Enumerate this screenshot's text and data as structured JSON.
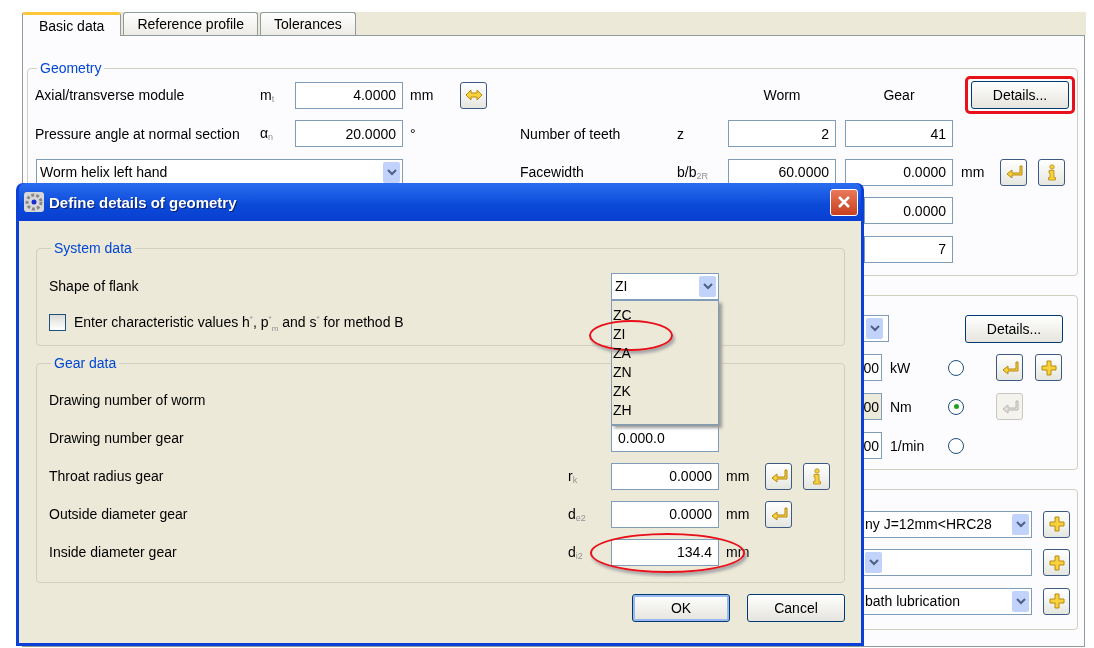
{
  "tabs": [
    {
      "label": "Basic data",
      "selected": true
    },
    {
      "label": "Reference profile",
      "selected": false
    },
    {
      "label": "Tolerances",
      "selected": false
    }
  ],
  "geometry": {
    "title": "Geometry",
    "column_headers": [
      "Worm",
      "Gear"
    ],
    "details_button": {
      "label": "Details...",
      "highlighted": true
    },
    "module": {
      "label": "Axial/transverse module",
      "symbol": "m$_{t}$",
      "value": "4.0000",
      "unit": "mm"
    },
    "pressure_angle": {
      "label": "Pressure angle at normal section",
      "symbol": "α$_{n}$",
      "value": "20.0000",
      "unit": "°"
    },
    "helix": {
      "value": "Worm helix left hand"
    },
    "teeth": {
      "label": "Number of teeth",
      "symbol": "z",
      "worm": "2",
      "gear": "41"
    },
    "facewidth": {
      "label": "Facewidth",
      "symbol": "b/b$_{2R}$",
      "worm": "60.0000",
      "gear": "0.0000",
      "unit": "mm"
    },
    "row_4": {
      "gear": "0.0000"
    },
    "row_5": {
      "gear": "7"
    }
  },
  "group_2": {
    "details_button": {
      "label": "Details..."
    },
    "rows": [
      {
        "value": "00",
        "unit": "kW",
        "selected": false,
        "disabled": false,
        "buttons": [
          {
            "kind": "enter",
            "disabled": false
          },
          {
            "kind": "plus",
            "disabled": false
          }
        ]
      },
      {
        "value": "00",
        "unit": "Nm",
        "selected": true,
        "disabled": true,
        "buttons": [
          {
            "kind": "enter",
            "disabled": true
          }
        ]
      },
      {
        "value": "00",
        "unit": "1/min",
        "selected": false,
        "disabled": false
      }
    ]
  },
  "group_3": {
    "rows": [
      {
        "value": "ny J=12mm<HRC28",
        "buttons": [
          {
            "kind": "plus",
            "disabled": false
          }
        ]
      },
      {
        "buttons": [
          {
            "kind": "plus",
            "disabled": false
          }
        ]
      },
      {
        "value": "bath lubrication",
        "buttons": [
          {
            "kind": "plus",
            "disabled": false
          }
        ]
      }
    ]
  },
  "dialog": {
    "title": "Define details of geometry",
    "system_data": {
      "title": "System data",
      "flank": {
        "label": "Shape of flank",
        "value": "ZI",
        "expanded": true,
        "options": [
          {
            "label": "ZC",
            "highlighted": false
          },
          {
            "label": "ZI",
            "highlighted": true
          },
          {
            "label": "ZA",
            "highlighted": false
          },
          {
            "label": "ZN",
            "highlighted": false
          },
          {
            "label": "ZK",
            "highlighted": false
          },
          {
            "label": "ZH",
            "highlighted": false
          }
        ]
      },
      "method_b": {
        "label": "Enter characteristic values h$^{*}$, p$^{*}$$_{m}$ and s$^{*}$ for method B",
        "checked": false
      }
    },
    "gear_data": {
      "title": "Gear data",
      "rows": [
        {
          "label": "Drawing number of worm"
        },
        {
          "label": "Drawing number gear",
          "kind": "text",
          "value": "0.000.0"
        },
        {
          "label": "Throat radius gear",
          "kind": "number",
          "symbol": "r$_{k}$",
          "value": "0.0000",
          "unit": "mm",
          "buttons": [
            {
              "kind": "enter",
              "disabled": false
            },
            {
              "kind": "info",
              "disabled": false
            }
          ]
        },
        {
          "label": "Outside diameter gear",
          "kind": "number",
          "symbol": "d$_{e2}$",
          "value": "0.0000",
          "unit": "mm",
          "buttons": [
            {
              "kind": "enter",
              "disabled": false
            }
          ]
        },
        {
          "label": "Inside diameter gear",
          "kind": "number",
          "symbol": "d$_{i2}$",
          "value": "134.4",
          "unit": "mm",
          "highlighted": true
        }
      ]
    },
    "buttons": [
      {
        "label": "OK",
        "default": true
      },
      {
        "label": "Cancel",
        "default": false
      }
    ]
  }
}
